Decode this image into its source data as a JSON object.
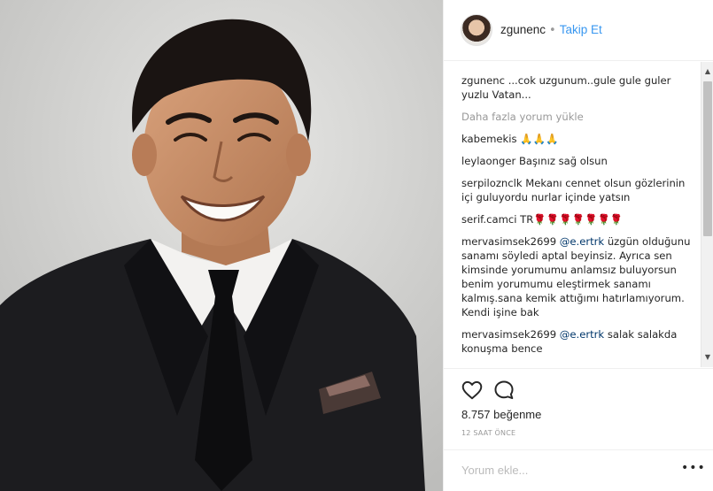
{
  "post": {
    "image_alt": "Portrait of a smiling man in a black suit and tie"
  },
  "header": {
    "username": "zgunenc",
    "separator": "•",
    "follow_label": "Takip Et"
  },
  "comments": {
    "caption": {
      "user": "zgunenc",
      "text": "...cok uzgunum..gule gule guler yuzlu Vatan..."
    },
    "load_more": "Daha fazla yorum yükle",
    "items": [
      {
        "user": "kabemekis",
        "text": "🙏🙏🙏"
      },
      {
        "user": "leylaonger",
        "text": "Başınız sağ olsun"
      },
      {
        "user": "serpiloznclk",
        "text": "Mekanı cennet olsun gözlerinin içi guluyordu nurlar içinde yatsın"
      },
      {
        "user": "serif.camci",
        "text": "TR🌹🌹🌹🌹🌹🌹🌹"
      },
      {
        "user": "mervasimsek2699",
        "mention": "@e.ertrk",
        "text": "üzgün olduğunu sanamı söyledi aptal beyinsiz. Ayrıca sen kimsinde yorumumu anlamsız buluyorsun benim yorumumu eleştirmek sanamı kalmış.sana kemik attığımı hatırlamıyorum. Kendi işine bak"
      },
      {
        "user": "mervasimsek2699",
        "mention": "@e.ertrk",
        "text": "salak salakda konuşma bence"
      }
    ]
  },
  "actions": {
    "like_icon": "heart-icon",
    "comment_icon": "comment-bubble-icon",
    "likes_text": "8.757 beğenme",
    "time_text": "12 SAAT ÖNCE"
  },
  "add_comment": {
    "placeholder": "Yorum ekle...",
    "more_icon": "more-options-icon",
    "more_label": "•••"
  },
  "colors": {
    "link_blue": "#3897f0",
    "mention": "#00376b",
    "muted": "#999999",
    "border": "#efefef"
  }
}
